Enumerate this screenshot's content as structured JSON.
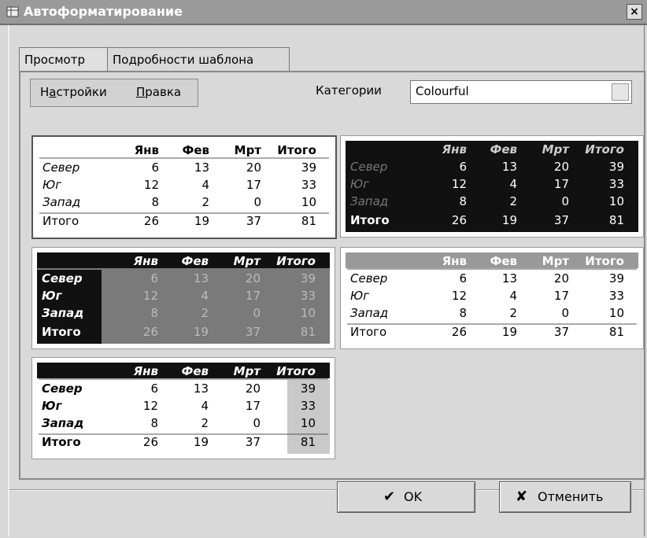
{
  "window": {
    "title": "Автоформатирование",
    "close": "×"
  },
  "tabs": [
    {
      "label": "Просмотр",
      "active": true
    },
    {
      "label": "Подробности шаблона",
      "active": false
    }
  ],
  "menu": {
    "settings_prefix": "Н",
    "settings_hot": "а",
    "settings_rest": "стройки",
    "edit_hot": "П",
    "edit_rest": "равка"
  },
  "category": {
    "label": "Категории",
    "value": "Colourful"
  },
  "table": {
    "headers": [
      "Янв",
      "Фев",
      "Мрт",
      "Итого"
    ],
    "rows": [
      {
        "label": "Север",
        "values": [
          "6",
          "13",
          "20",
          "39"
        ]
      },
      {
        "label": "Юг",
        "values": [
          "12",
          "4",
          "17",
          "33"
        ]
      },
      {
        "label": "Запад",
        "values": [
          "8",
          "2",
          "0",
          "10"
        ]
      },
      {
        "label": "Итого",
        "values": [
          "26",
          "19",
          "37",
          "81"
        ]
      }
    ]
  },
  "buttons": {
    "ok": "OK",
    "cancel": "Отменить"
  }
}
